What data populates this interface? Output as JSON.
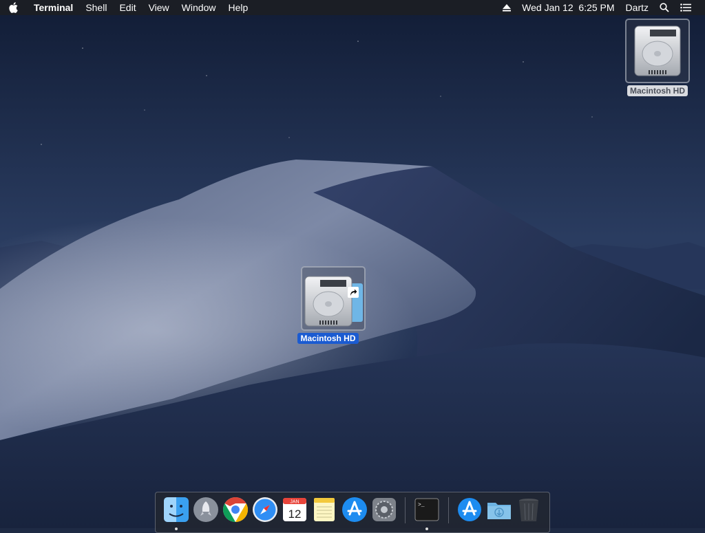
{
  "menubar": {
    "apple_icon": "apple-logo-icon",
    "app_name": "Terminal",
    "menus": [
      "Shell",
      "Edit",
      "View",
      "Window",
      "Help"
    ],
    "status": {
      "eject_icon": "eject-icon",
      "datetime": "Wed Jan 12  6:25 PM",
      "user": "Dartz",
      "search_icon": "spotlight-search-icon",
      "notification_icon": "notification-center-icon"
    }
  },
  "desktop": {
    "disk_top_label": "Macintosh HD",
    "disk_drag_label": "Macintosh HD",
    "alias_icon": "alias-arrow-icon"
  },
  "dock": {
    "apps": [
      {
        "label": "Finder",
        "icon": "finder-icon",
        "running": true
      },
      {
        "label": "Launchpad",
        "icon": "launchpad-icon",
        "running": false
      },
      {
        "label": "Google Chrome",
        "icon": "chrome-icon",
        "running": false
      },
      {
        "label": "Safari",
        "icon": "safari-icon",
        "running": false
      },
      {
        "label": "Calendar",
        "icon": "calendar-icon",
        "running": false,
        "month": "JAN",
        "day": "12"
      },
      {
        "label": "Notes",
        "icon": "notes-icon",
        "running": false
      },
      {
        "label": "App Store",
        "icon": "app-store-icon",
        "running": false
      },
      {
        "label": "System Preferences",
        "icon": "system-preferences-icon",
        "running": false
      },
      {
        "label": "Terminal",
        "icon": "terminal-icon",
        "running": true,
        "prompt": ">_"
      },
      {
        "label": "Applications",
        "icon": "applications-folder-icon",
        "running": false
      },
      {
        "label": "Downloads",
        "icon": "downloads-folder-icon",
        "running": false
      },
      {
        "label": "Trash",
        "icon": "trash-icon",
        "running": false
      }
    ]
  },
  "colors": {
    "sky_top": "#0f1a33",
    "sky_mid": "#243659",
    "dune_light": "#8f9bb3",
    "dune_dark": "#1d2a47",
    "selection_blue": "#1b5bd1"
  }
}
